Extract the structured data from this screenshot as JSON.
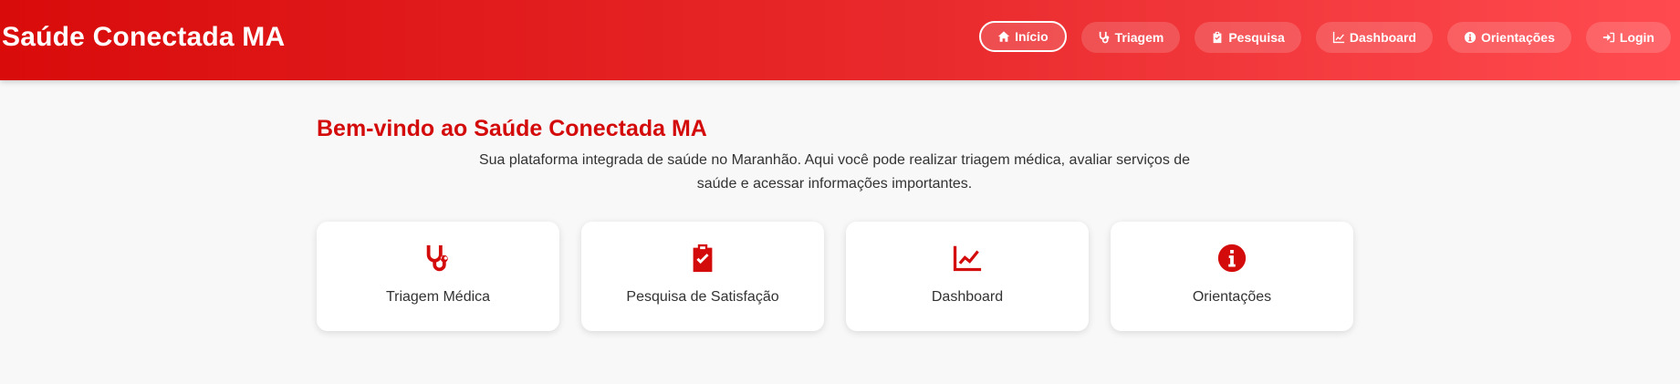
{
  "header": {
    "brand": "Saúde Conectada MA",
    "nav": [
      {
        "label": "Início",
        "icon": "home-icon",
        "active": true
      },
      {
        "label": "Triagem",
        "icon": "stethoscope-icon",
        "active": false
      },
      {
        "label": "Pesquisa",
        "icon": "clipboard-check-icon",
        "active": false
      },
      {
        "label": "Dashboard",
        "icon": "chart-line-icon",
        "active": false
      },
      {
        "label": "Orientações",
        "icon": "info-circle-icon",
        "active": false
      },
      {
        "label": "Login",
        "icon": "sign-in-icon",
        "active": false
      }
    ]
  },
  "main": {
    "title": "Bem-vindo ao Saúde Conectada MA",
    "intro": "Sua plataforma integrada de saúde no Maranhão. Aqui você pode realizar triagem médica, avaliar serviços de saúde e acessar informações importantes.",
    "cards": [
      {
        "label": "Triagem Médica",
        "icon": "stethoscope-icon"
      },
      {
        "label": "Pesquisa de Satisfação",
        "icon": "clipboard-check-icon"
      },
      {
        "label": "Dashboard",
        "icon": "chart-line-icon"
      },
      {
        "label": "Orientações",
        "icon": "info-circle-icon"
      }
    ]
  },
  "colors": {
    "accent": "#d40b0b",
    "header_start": "#d90b0b",
    "header_end": "#ff4b50",
    "background": "#f8f8f8"
  }
}
